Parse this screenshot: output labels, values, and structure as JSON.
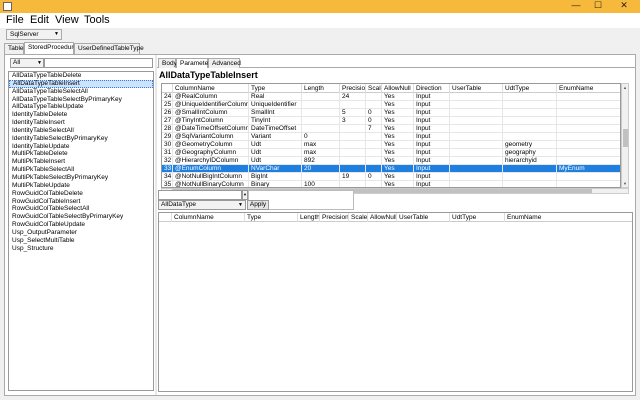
{
  "window": {
    "controls": [
      "—",
      "☐",
      "✕"
    ]
  },
  "menubar": [
    "File",
    "Edit",
    "View",
    "Tools"
  ],
  "provider": {
    "value": "SqlServer"
  },
  "top_tabs": [
    "Table",
    "StoredProcedure",
    "UserDefinedTableType"
  ],
  "filter": {
    "value": "All"
  },
  "procedures": [
    "AllDataTypeTableDelete",
    "AllDataTypeTableInsert",
    "AllDataTypeTableSelectAll",
    "AllDataTypeTableSelectByPrimaryKey",
    "AllDataTypeTableUpdate",
    "IdentityTableDelete",
    "IdentityTableInsert",
    "IdentityTableSelectAll",
    "IdentityTableSelectByPrimaryKey",
    "IdentityTableUpdate",
    "MultiPkTableDelete",
    "MultiPkTableInsert",
    "MultiPkTableSelectAll",
    "MultiPkTableSelectByPrimaryKey",
    "MultiPkTableUpdate",
    "RowGuidColTableDelete",
    "RowGuidColTableInsert",
    "RowGuidColTableSelectAll",
    "RowGuidColTableSelectByPrimaryKey",
    "RowGuidColTableUpdate",
    "Usp_OutputParameter",
    "Usp_SelectMultiTable",
    "Usp_Structure"
  ],
  "sub_tabs": [
    "Body",
    "Parameter",
    "Advanced"
  ],
  "procedure_title": "AllDataTypeTableInsert",
  "param_grid": {
    "headers": [
      "",
      "ColumnName",
      "Type",
      "Length",
      "Precision",
      "Scale",
      "AllowNull",
      "Direction",
      "UserTable",
      "UdtType",
      "EnumName"
    ],
    "rows": [
      [
        "24",
        "@RealColumn",
        "Real",
        "",
        "24",
        "",
        "Yes",
        "Input",
        "",
        "",
        ""
      ],
      [
        "25",
        "@UniqueIdentifierColumn",
        "UniqueIdentifier",
        "",
        "",
        "",
        "Yes",
        "Input",
        "",
        "",
        ""
      ],
      [
        "26",
        "@SmallIntColumn",
        "SmallInt",
        "",
        "5",
        "0",
        "Yes",
        "Input",
        "",
        "",
        ""
      ],
      [
        "27",
        "@TinyIntColumn",
        "TinyInt",
        "",
        "3",
        "0",
        "Yes",
        "Input",
        "",
        "",
        ""
      ],
      [
        "28",
        "@DateTimeOffsetColumn",
        "DateTimeOffset",
        "",
        "",
        "7",
        "Yes",
        "Input",
        "",
        "",
        ""
      ],
      [
        "29",
        "@SqlVariantColumn",
        "Variant",
        "0",
        "",
        "",
        "Yes",
        "Input",
        "",
        "",
        ""
      ],
      [
        "30",
        "@GeometryColumn",
        "Udt",
        "max",
        "",
        "",
        "Yes",
        "Input",
        "",
        "geometry",
        ""
      ],
      [
        "31",
        "@GeographyColumn",
        "Udt",
        "max",
        "",
        "",
        "Yes",
        "Input",
        "",
        "geography",
        ""
      ],
      [
        "32",
        "@HierarchyIDColumn",
        "Udt",
        "892",
        "",
        "",
        "Yes",
        "Input",
        "",
        "hierarchyid",
        ""
      ],
      [
        "33",
        "@EnumColumn",
        "NVarChar",
        "20",
        "",
        "",
        "Yes",
        "Input",
        "",
        "",
        "MyEnum"
      ],
      [
        "34",
        "@NotNullBigIntColumn",
        "BigInt",
        "",
        "19",
        "0",
        "Yes",
        "Input",
        "",
        "",
        ""
      ],
      [
        "35",
        "@NotNullBinaryColumn",
        "Binary",
        "100",
        "",
        "",
        "Yes",
        "Input",
        "",
        "",
        ""
      ]
    ],
    "selected_index": 9
  },
  "type_selector": {
    "value": "AllDataType",
    "apply_label": "Apply"
  },
  "udt_grid": {
    "headers": [
      "",
      "ColumnName",
      "Type",
      "Length",
      "Precision",
      "Scale",
      "AllowNull",
      "UserTable",
      "UdtType",
      "EnumName"
    ]
  }
}
